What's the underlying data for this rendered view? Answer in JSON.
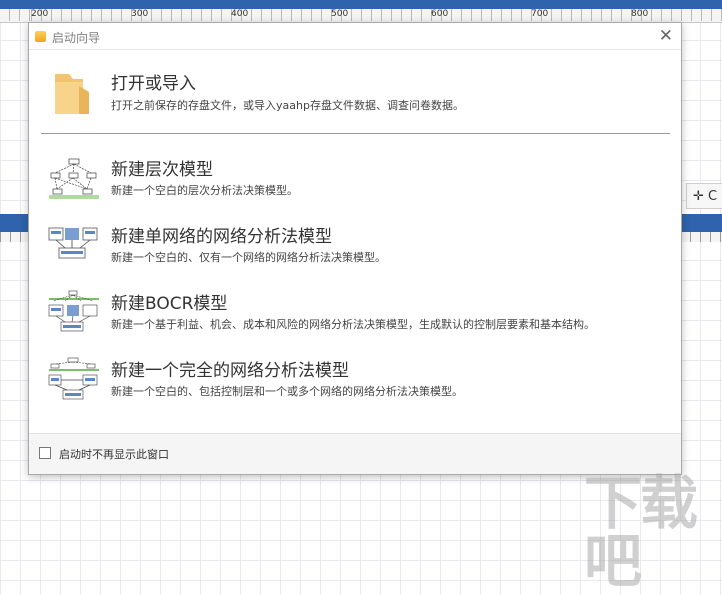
{
  "ruler": {
    "labels": [
      "200",
      "300",
      "400",
      "500",
      "600",
      "700",
      "800"
    ]
  },
  "background_tool": {
    "icon": "move-icon",
    "text": "C"
  },
  "dialog": {
    "title": "启动向导",
    "close_glyph": "✕",
    "open": {
      "title": "打开或导入",
      "desc": "打开之前保存的存盘文件，或导入yaahp存盘文件数据、调查问卷数据。",
      "icon": "folder-icon"
    },
    "entries": [
      {
        "title": "新建层次模型",
        "desc": "新建一个空白的层次分析法决策模型。",
        "icon": "hierarchy-model-icon"
      },
      {
        "title": "新建单网络的网络分析法模型",
        "desc": "新建一个空白的、仅有一个网络的网络分析法决策模型。",
        "icon": "single-network-anp-icon"
      },
      {
        "title": "新建BOCR模型",
        "desc": "新建一个基于利益、机会、成本和风险的网络分析法决策模型，生成默认的控制层要素和基本结构。",
        "icon": "bocr-model-icon"
      },
      {
        "title": "新建一个完全的网络分析法模型",
        "desc": "新建一个空白的、包括控制层和一个或多个网络的网络分析法决策模型。",
        "icon": "full-anp-model-icon"
      }
    ],
    "footer": {
      "checkbox_label": "启动时不再显示此窗口",
      "checked": false
    }
  },
  "watermark": "下载吧"
}
